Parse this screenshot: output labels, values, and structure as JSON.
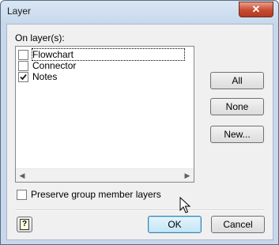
{
  "window": {
    "title": "Layer",
    "close_glyph": "✕"
  },
  "layers_label": "On layer(s):",
  "layers": [
    {
      "name": "Flowchart",
      "checked": false,
      "focused": true
    },
    {
      "name": "Connector",
      "checked": false,
      "focused": false
    },
    {
      "name": "Notes",
      "checked": true,
      "focused": false
    }
  ],
  "buttons": {
    "all": "All",
    "none": "None",
    "new": "New...",
    "ok": "OK",
    "cancel": "Cancel"
  },
  "preserve_label": "Preserve group member layers",
  "preserve_checked": false,
  "help_glyph": "?",
  "icons": {
    "close": "close-icon",
    "help": "help-icon",
    "scroll_left": "scroll-left-icon",
    "scroll_right": "scroll-right-icon",
    "cursor": "mouse-pointer-icon"
  }
}
